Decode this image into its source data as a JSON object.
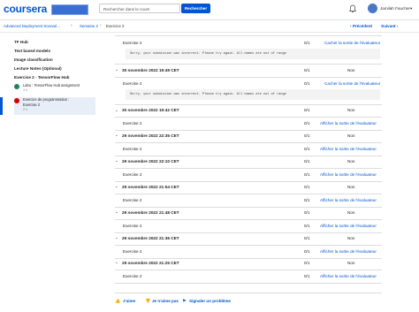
{
  "header": {
    "logo": "coursera",
    "search_placeholder": "Rechercher dans le cours",
    "search_button": "Rechercher",
    "user_name": "Jamilah Faucher"
  },
  "breadcrumb": {
    "items": [
      "Advanced Deployment Scenari...",
      "Semaine 2",
      "Exercice 2"
    ],
    "prev": "Précédent",
    "next": "Suivant"
  },
  "sidebar": {
    "items": [
      "TF Hub",
      "Text based models",
      "Image classification",
      "Lecture Notes (Optional)",
      "Exercise 2 - TensorFlow Hub"
    ],
    "sub1": {
      "line1": "Labo : TensorFlow Hub assignment",
      "line2": "1 h"
    },
    "sub2": {
      "line1": "Exercice de programmation :",
      "line2": "Exercise 2",
      "line3": "2 h"
    }
  },
  "main": {
    "first_row": {
      "label": "Exercise 2",
      "score": "0/1",
      "link": "Cacher la sortie de l'évaluateur"
    },
    "message": "Sorry, your submission was incorrect. Please try again. All names are out of range",
    "groups": [
      {
        "date": "30 novembre 2022 19:49 CET",
        "score": "0/1",
        "status": "Non",
        "label": "Exercise 2",
        "link": "Cacher la sortie de l'évaluateur",
        "message": "Sorry, your submission was incorrect. Please try again. All names are out of range"
      },
      {
        "date": "30 novembre 2022 19:42 CET",
        "score": "0/1",
        "status": "Non",
        "label": "Exercise 2",
        "link": "Afficher la sortie de l'évaluateur"
      },
      {
        "date": "29 novembre 2022 22:35 CET",
        "score": "0/1",
        "status": "Non",
        "label": "Exercise 2",
        "link": "Afficher la sortie de l'évaluateur"
      },
      {
        "date": "29 novembre 2022 22:10 CET",
        "score": "0/1",
        "status": "Non",
        "label": "Exercise 2",
        "link": "Afficher la sortie de l'évaluateur"
      },
      {
        "date": "29 novembre 2022 21:54 CET",
        "score": "0/1",
        "status": "Non",
        "label": "Exercise 2",
        "link": "Afficher la sortie de l'évaluateur"
      },
      {
        "date": "29 novembre 2022 21:48 CET",
        "score": "0/1",
        "status": "Non",
        "label": "Exercise 2",
        "link": "Afficher la sortie de l'évaluateur"
      },
      {
        "date": "29 novembre 2022 21:36 CET",
        "score": "0/1",
        "status": "Non",
        "label": "Exercise 2",
        "link": "Afficher la sortie de l'évaluateur"
      },
      {
        "date": "29 novembre 2022 21:25 CET",
        "score": "0/1",
        "status": "Non",
        "label": "Exercise 2",
        "link": "Afficher la sortie de l'évaluateur"
      }
    ]
  },
  "footer": {
    "like": "J'aime",
    "dislike": "Je n'aime pas",
    "report": "Signaler un problème"
  }
}
